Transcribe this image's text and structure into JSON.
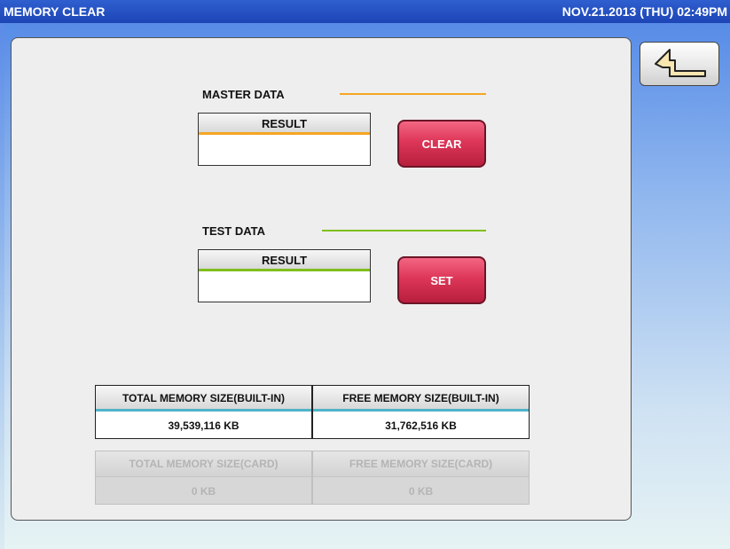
{
  "window": {
    "title": "MEMORY CLEAR",
    "datetime": "NOV.21.2013 (THU)  02:49PM"
  },
  "back_button": {
    "icon": "return-arrow-icon"
  },
  "master_data": {
    "label": "MASTER DATA",
    "result_header": "RESULT",
    "result_value": "",
    "button_label": "CLEAR",
    "accent_color": "#f5a623"
  },
  "test_data": {
    "label": "TEST DATA",
    "result_header": "RESULT",
    "result_value": "",
    "button_label": "SET",
    "accent_color": "#7fbf1d"
  },
  "memory": {
    "builtin_total_label": "TOTAL MEMORY SIZE(BUILT-IN)",
    "builtin_total_value": "39,539,116 KB",
    "builtin_free_label": "FREE MEMORY SIZE(BUILT-IN)",
    "builtin_free_value": "31,762,516 KB",
    "card_total_label": "TOTAL MEMORY SIZE(CARD)",
    "card_total_value": "0 KB",
    "card_free_label": "FREE MEMORY SIZE(CARD)",
    "card_free_value": "0 KB"
  },
  "colors": {
    "title_bar": "#1d45b5",
    "action_button": "#dd3658",
    "memory_accent": "#4fb3c9"
  }
}
